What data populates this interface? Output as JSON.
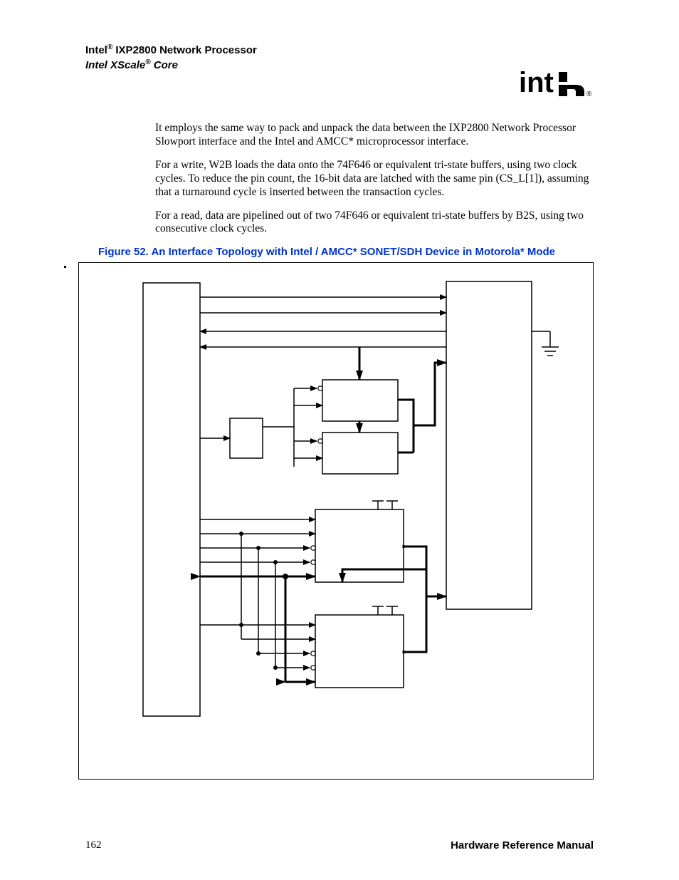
{
  "header": {
    "line1_prefix": "Intel",
    "line1_sup": "®",
    "line1_rest": " IXP2800 Network Processor",
    "line2_prefix": "Intel XScale",
    "line2_sup": "®",
    "line2_rest": " Core"
  },
  "paragraphs": {
    "p1": "It employs the same way to pack and unpack the data between the IXP2800 Network Processor Slowport interface and the Intel and AMCC* microprocessor interface.",
    "p2": "For a write, W2B loads the data onto the 74F646 or equivalent tri-state buffers, using two clock cycles. To reduce the pin count, the 16-bit data are latched with the same pin (CS_L[1]), assuming that a turnaround cycle is inserted between the transaction cycles.",
    "p3": "For a read, data are pipelined out of two 74F646 or equivalent tri-state buffers by B2S, using two consecutive clock cycles."
  },
  "figure": {
    "caption": "Figure 52. An Interface Topology with Intel / AMCC* SONET/SDH Device in Motorola* Mode"
  },
  "footer": {
    "page_number": "162",
    "manual_title": "Hardware Reference Manual"
  },
  "logo": {
    "name": "intel-logo",
    "registered": "®"
  }
}
